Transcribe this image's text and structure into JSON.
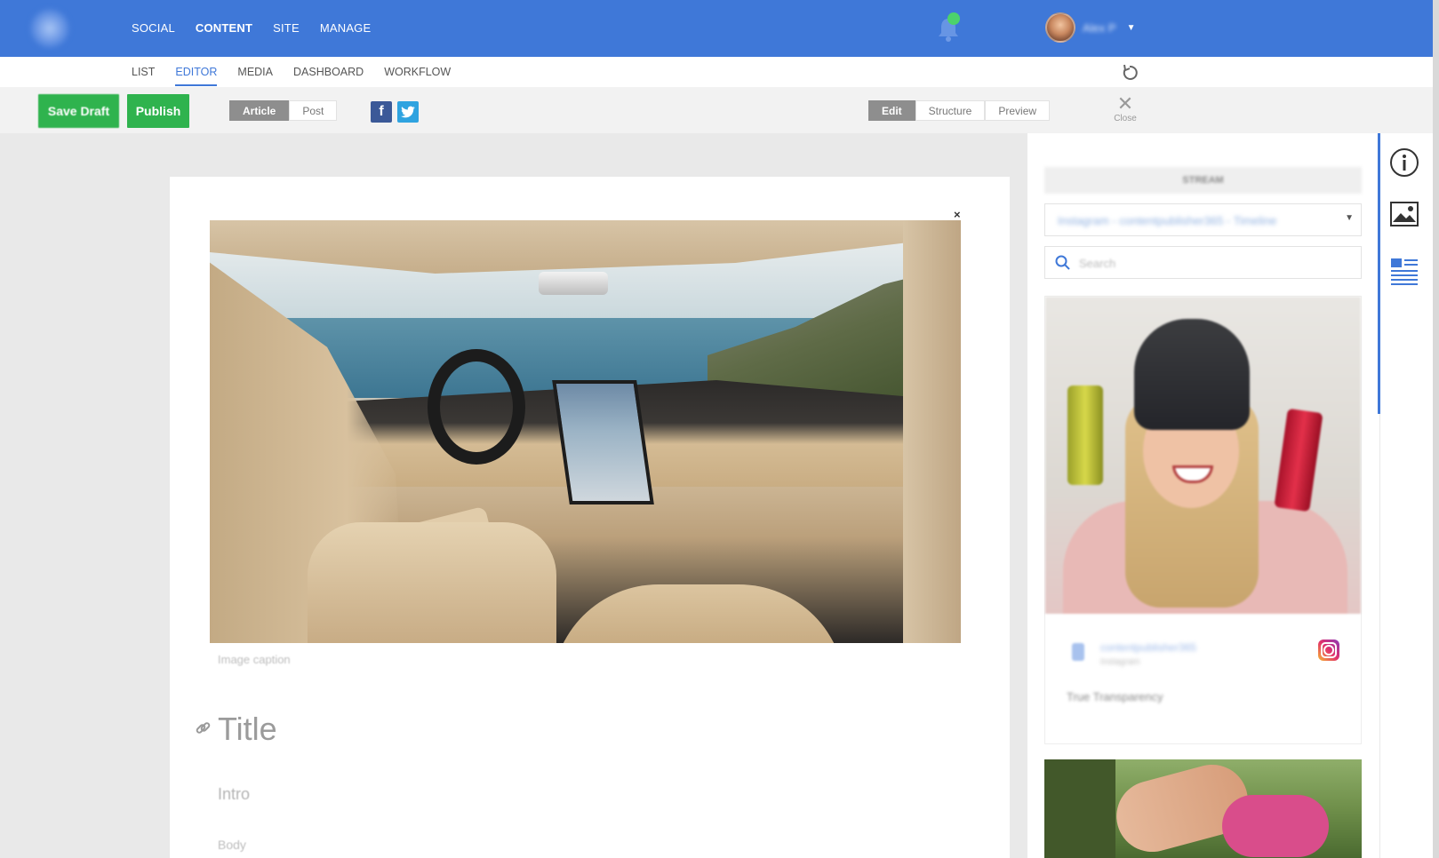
{
  "topnav": {
    "items": [
      "SOCIAL",
      "CONTENT",
      "SITE",
      "MANAGE"
    ],
    "active": "CONTENT",
    "user_name": "Alex P"
  },
  "subnav": {
    "items": [
      "LIST",
      "EDITOR",
      "MEDIA",
      "DASHBOARD",
      "WORKFLOW"
    ],
    "active": "EDITOR"
  },
  "toolbar": {
    "save_draft_label": "Save Draft",
    "publish_label": "Publish",
    "type_options": [
      "Article",
      "Post"
    ],
    "type_selected": "Article",
    "view_options": [
      "Edit",
      "Structure",
      "Preview"
    ],
    "view_selected": "Edit",
    "close_label": "Close",
    "close_glyph": "✕"
  },
  "editor": {
    "remove_image_glyph": "×",
    "caption_placeholder": "Image caption",
    "title_placeholder": "Title",
    "intro_placeholder": "Intro",
    "body_placeholder": "Body"
  },
  "panel": {
    "header": "STREAM",
    "source_select_value": "Instagram - contentpublisher365 - Timeline",
    "search_placeholder": "Search",
    "posts": [
      {
        "author": "contentpublisher365",
        "subtitle": "Instagram",
        "text": "True Transparency",
        "network_icon": "instagram-icon"
      }
    ]
  },
  "colors": {
    "brand_blue": "#3f78d8",
    "action_green": "#2fb34e",
    "facebook": "#3b5998",
    "twitter": "#2fa3e0"
  },
  "icons": [
    "bell-icon",
    "refresh-icon",
    "facebook-icon",
    "twitter-icon",
    "link-icon",
    "search-icon",
    "info-icon",
    "image-icon",
    "article-icon",
    "instagram-icon"
  ]
}
